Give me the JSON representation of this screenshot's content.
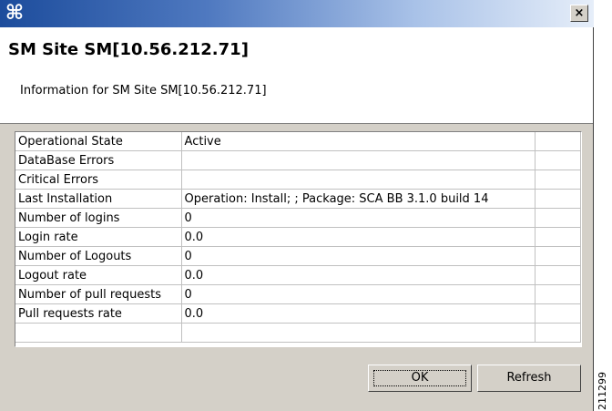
{
  "window": {
    "icon": "cisco-app-icon",
    "close_label": "×"
  },
  "header": {
    "title": "SM Site SM[10.56.212.71]",
    "subtitle": "Information for SM Site SM[10.56.212.71]"
  },
  "table": {
    "rows": [
      {
        "name": "Operational State",
        "value": "Active"
      },
      {
        "name": "DataBase Errors",
        "value": ""
      },
      {
        "name": "Critical Errors",
        "value": ""
      },
      {
        "name": "Last Installation",
        "value": "Operation: Install; ; Package: SCA BB 3.1.0 build 14"
      },
      {
        "name": "Number of logins",
        "value": "0"
      },
      {
        "name": "Login rate",
        "value": "0.0"
      },
      {
        "name": "Number of Logouts",
        "value": "0"
      },
      {
        "name": "Logout rate",
        "value": "0.0"
      },
      {
        "name": "Number of pull requests",
        "value": "0"
      },
      {
        "name": "Pull requests rate",
        "value": "0.0"
      },
      {
        "name": "",
        "value": ""
      }
    ]
  },
  "buttons": {
    "ok_label": "OK",
    "refresh_label": "Refresh"
  },
  "side_label": "211299"
}
